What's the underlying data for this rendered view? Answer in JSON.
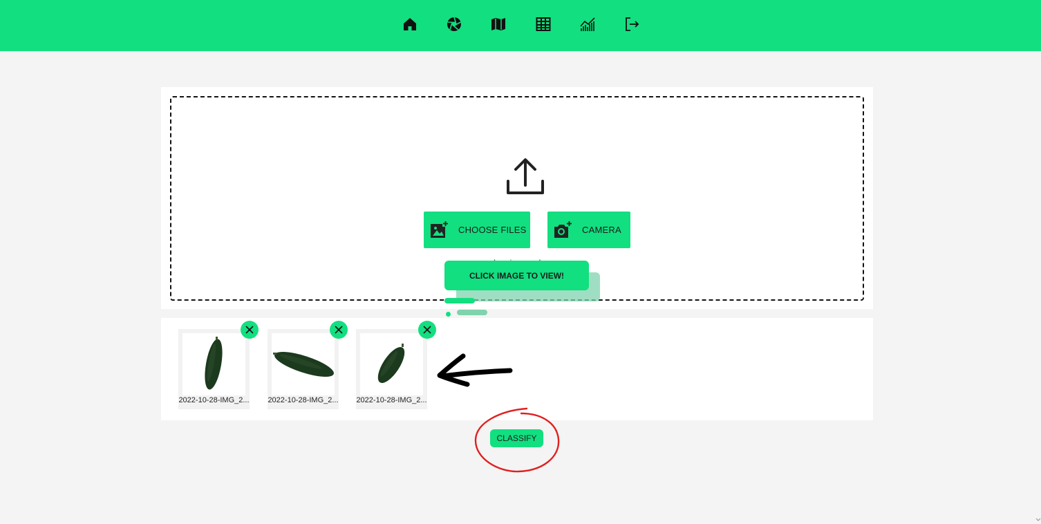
{
  "nav": {
    "items": [
      {
        "icon": "home-icon",
        "label": "Home"
      },
      {
        "icon": "aperture-icon",
        "label": "Classify"
      },
      {
        "icon": "map-icon",
        "label": "Map"
      },
      {
        "icon": "table-icon",
        "label": "Table"
      },
      {
        "icon": "chart-icon",
        "label": "Statistics"
      },
      {
        "icon": "logout-icon",
        "label": "Logout"
      }
    ]
  },
  "upload": {
    "choose_files_label": "CHOOSE FILES",
    "camera_label": "CAMERA",
    "drop_text": "or drop images here"
  },
  "tooltip": {
    "text": "CLICK IMAGE TO VIEW!"
  },
  "thumbnails": [
    {
      "name": "2022-10-28-IMG_2..."
    },
    {
      "name": "2022-10-28-IMG_2..."
    },
    {
      "name": "2022-10-28-IMG_2..."
    }
  ],
  "classify_label": "CLASSIFY",
  "colors": {
    "accent": "#12df80",
    "accent_light": "#7fd3ad",
    "annotation_red": "#e02020",
    "annotation_black": "#000000"
  }
}
